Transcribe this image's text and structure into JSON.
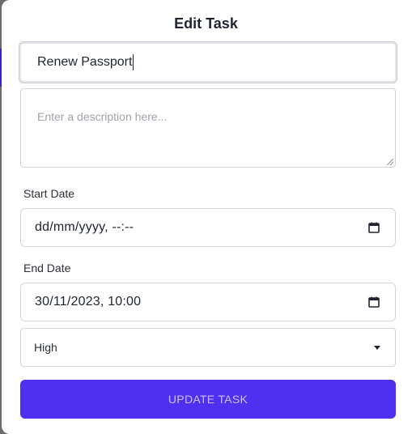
{
  "modal": {
    "title": "Edit Task"
  },
  "form": {
    "title_value": "Renew Passport",
    "description_placeholder": "Enter a description here...",
    "description_value": "",
    "start_date": {
      "label": "Start Date",
      "value": "dd/mm/yyyy, --:--"
    },
    "end_date": {
      "label": "End Date",
      "value": "30/11/2023, 10:00"
    },
    "priority": {
      "selected": "High"
    },
    "submit_label": "UPDATE TASK"
  },
  "colors": {
    "accent": "#4f2ff0",
    "button_text": "#c9c2ff",
    "backdrop": "#6b6b6b"
  },
  "icons": {
    "date_picker": "calendar-icon",
    "select_arrow": "caret-down-icon"
  }
}
